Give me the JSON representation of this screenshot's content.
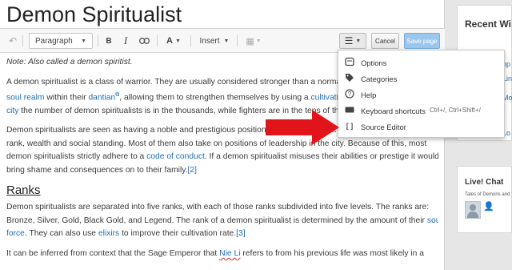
{
  "page_title": "Demon Spiritualist",
  "toolbar": {
    "undo_icon": "undo-icon",
    "paragraph_label": "Paragraph",
    "bold_label": "B",
    "italic_label": "I",
    "link_icon": "link-icon",
    "text_style_label": "A",
    "insert_label": "Insert",
    "table_icon": "table-icon",
    "menu_icon": "hamburger-icon",
    "cancel_label": "Cancel",
    "save_label": "Save page"
  },
  "content": {
    "note": "Note: Also called a demon spiritist.",
    "p1": {
      "l1": "A demon spiritualist is a class of warrior. They are usually considered stronger than a norma",
      "l2a": "soul realm",
      "l2b": " within their ",
      "l2c": "dantian",
      "l2d": ", allowing them to strengthen themselves by using a ",
      "l2e": "cultivati",
      "l3a": "city",
      "l3b": " the number of demon spiritualists is in the thousands, while fighters are in the tens of th"
    },
    "p2": {
      "l1": "Demon spiritualists are seen as having a noble and prestigious position; obtaining the rank w",
      "l2": "rank, wealth and social standing. Most of them also take on positions of leadership in the city. Because of this, most",
      "l3a": "demon spiritualists strictly adhere to a ",
      "l3b": "code of conduct",
      "l3c": ". If a demon spiritualist misuses their abilities or prestige it would",
      "l4a": "bring shame and consequences on to their family.",
      "l4b": "[2]"
    },
    "heading": "Ranks",
    "p3": {
      "l1": "Demon spiritualists are separated into five ranks, with each of those ranks subdivided into five levels. The ranks are:",
      "l2a": "Bronze, Silver, Gold, Black Gold, and Legend. The rank of a demon spiritualist is determined by the amount of their ",
      "l2b": "soul",
      "l3a": "force",
      "l3b": ". They can also use ",
      "l3c": "elixirs",
      "l3d": " to improve their cultivation rate.",
      "l3e": "[3]"
    },
    "p4": {
      "l1a": "It can be inferred from context that the Sage Emperor that ",
      "l1b": "Nie Li",
      "l1c": " refers to from his previous life was most likely in a"
    }
  },
  "menu": {
    "items": [
      {
        "label": "Options",
        "icon": "options-icon"
      },
      {
        "label": "Categories",
        "icon": "tag-icon"
      },
      {
        "label": "Help",
        "icon": "help-icon"
      },
      {
        "label": "Keyboard shortcuts",
        "icon": "keyboard-icon",
        "shortcut": "Ctrl+/, Ctrl+Shift+/"
      },
      {
        "label": "Source Editor",
        "icon": "brackets-icon",
        "glyph": "[ ]"
      }
    ]
  },
  "sidebar": {
    "recent_title": "Recent Wi",
    "recent_frags": [
      "op",
      "Lin",
      "Mo",
      "Lo"
    ],
    "chat_title": "Live! Chat",
    "chat_subtitle": "Tales of Demons and"
  },
  "colors": {
    "link": "#1f6fb2",
    "save_button": "#9cc7ec",
    "arrow": "#e2141b"
  }
}
